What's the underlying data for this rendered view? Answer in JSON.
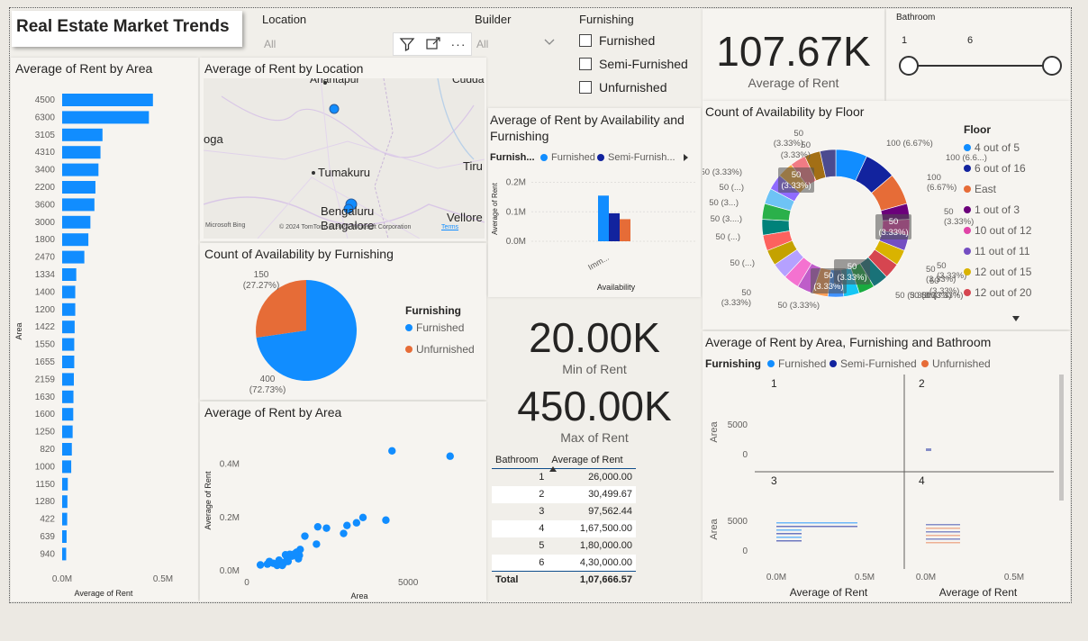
{
  "title": "Real Estate Market Trends",
  "slicers": {
    "location": {
      "label": "Location",
      "value": "All"
    },
    "builder": {
      "label": "Builder",
      "value": "All"
    },
    "furnishing": {
      "label": "Furnishing",
      "options": [
        "Furnished",
        "Semi-Furnished",
        "Unfurnished"
      ]
    },
    "bathroom": {
      "label": "Bathroom",
      "min": "1",
      "max": "6"
    }
  },
  "kpis": {
    "avg_rent": {
      "value": "107.67K",
      "label": "Average of Rent"
    },
    "min_rent": {
      "value": "20.00K",
      "label": "Min of Rent"
    },
    "max_rent": {
      "value": "450.00K",
      "label": "Max of Rent"
    }
  },
  "visual_titles": {
    "area_bar": "Average of Rent by Area",
    "location_map": "Average of Rent by Location",
    "furnishing_pie": "Count of Availability by Furnishing",
    "area_scatter": "Average of Rent by Area",
    "availability_bar": "Average of Rent by Availability and Furnishing",
    "floor_donut": "Count of Availability by Floor",
    "small_multiples": "Average of Rent by Area, Furnishing and Bathroom"
  },
  "map": {
    "places": [
      "Anantapur",
      "Cudda",
      "oga",
      "Tumakuru",
      "Tiru",
      "Bengaluru",
      "Bangalore",
      "Vellore"
    ],
    "attribution": "© 2024 TomTom, © 2024 Microsoft Corporation",
    "terms": "Terms",
    "bing": "Microsoft Bing"
  },
  "table": {
    "headers": [
      "Bathroom",
      "Average of Rent"
    ],
    "rows": [
      [
        "1",
        "26,000.00"
      ],
      [
        "2",
        "30,499.67"
      ],
      [
        "3",
        "97,562.44"
      ],
      [
        "4",
        "1,67,500.00"
      ],
      [
        "5",
        "1,80,000.00"
      ],
      [
        "6",
        "4,30,000.00"
      ]
    ],
    "total": [
      "Total",
      "1,07,666.57"
    ]
  },
  "colors": {
    "furnished": "#118dff",
    "semi": "#12239e",
    "unfurnished": "#e66c37"
  },
  "chart_data": [
    {
      "type": "bar",
      "title": "Average of Rent by Area",
      "xlabel": "Average of Rent",
      "ylabel": "Area",
      "x_ticks": [
        "0.0M",
        "0.5M"
      ],
      "categories": [
        "4500",
        "6300",
        "3105",
        "4310",
        "3400",
        "2200",
        "3600",
        "3000",
        "1800",
        "2470",
        "1334",
        "1400",
        "1200",
        "1422",
        "1550",
        "1655",
        "2159",
        "1630",
        "1600",
        "1250",
        "820",
        "1000",
        "1150",
        "1280",
        "422",
        "639",
        "940"
      ],
      "values": [
        450000,
        430000,
        200000,
        190000,
        180000,
        165000,
        160000,
        140000,
        130000,
        110000,
        70000,
        65000,
        65000,
        62000,
        60000,
        60000,
        58000,
        56000,
        55000,
        52000,
        48000,
        45000,
        28000,
        26000,
        25000,
        22000,
        20000
      ],
      "xlim": [
        0,
        500000
      ]
    },
    {
      "type": "pie",
      "title": "Count of Availability by Furnishing",
      "legend_title": "Furnishing",
      "categories": [
        "Furnished",
        "Unfurnished"
      ],
      "values": [
        400,
        150
      ],
      "labels": [
        "400\n(72.73%)",
        "150\n(27.27%)"
      ]
    },
    {
      "type": "scatter",
      "title": "Average of Rent by Area",
      "xlabel": "Area",
      "ylabel": "Average of Rent",
      "x_ticks": [
        "0",
        "5000"
      ],
      "y_ticks": [
        "0.0M",
        "0.2M",
        "0.4M"
      ],
      "xlim": [
        0,
        7200
      ],
      "ylim": [
        0,
        500000
      ],
      "points": [
        [
          4500,
          450000
        ],
        [
          6300,
          430000
        ],
        [
          3600,
          200000
        ],
        [
          3400,
          180000
        ],
        [
          4310,
          190000
        ],
        [
          3105,
          170000
        ],
        [
          3000,
          140000
        ],
        [
          2470,
          160000
        ],
        [
          2200,
          165000
        ],
        [
          1800,
          130000
        ],
        [
          2159,
          100000
        ],
        [
          1655,
          80000
        ],
        [
          1550,
          70000
        ],
        [
          1422,
          60000
        ],
        [
          1334,
          62000
        ],
        [
          1400,
          55000
        ],
        [
          1200,
          60000
        ],
        [
          1630,
          58000
        ],
        [
          1600,
          45000
        ],
        [
          1250,
          48000
        ],
        [
          1000,
          40000
        ],
        [
          1150,
          30000
        ],
        [
          1280,
          35000
        ],
        [
          820,
          28000
        ],
        [
          940,
          20000
        ],
        [
          639,
          25000
        ],
        [
          422,
          22000
        ],
        [
          700,
          35000
        ],
        [
          1100,
          20000
        ],
        [
          1500,
          65000
        ]
      ]
    },
    {
      "type": "bar",
      "title": "Average of Rent by Availability and Furnishing",
      "legend_title": "Furnish...",
      "xlabel": "Availability",
      "ylabel": "Average of Rent",
      "y_ticks": [
        "0.0M",
        "0.1M",
        "0.2M"
      ],
      "ylim": [
        0,
        0.22
      ],
      "categories": [
        "Imm..."
      ],
      "series": [
        {
          "name": "Furnished",
          "values": [
            0.155
          ]
        },
        {
          "name": "Semi-Furnish...",
          "values": [
            0.095
          ]
        },
        {
          "name": "Unfurnished",
          "values": [
            0.075
          ]
        }
      ]
    },
    {
      "type": "pie",
      "title": "Count of Availability by Floor",
      "legend_title": "Floor",
      "legend": [
        "4 out of 5",
        "6 out of 16",
        "East",
        "1 out of 3",
        "10 out of 12",
        "11 out of 11",
        "12 out of 15",
        "12 out of 20"
      ],
      "values": [
        100,
        100,
        100,
        50,
        50,
        50,
        50,
        50,
        50,
        50,
        50,
        50,
        50,
        50,
        50,
        50,
        50,
        50,
        50,
        50,
        50,
        50,
        50,
        50,
        50,
        50
      ],
      "data_labels": [
        "100 (6.67%)",
        "100 (6.6...)",
        "100\n(6.67%)",
        "50\n(3.33%)",
        "50\n(3.33%)",
        "50\n(3.33%)",
        "50 (3.33%)",
        "50 (3.33%)",
        "50\n(3.33%)",
        "50 (3.33%)",
        "50 (3.33%)",
        "50\n(3.33%)",
        "50 (...)",
        "50 (...)",
        "50 (3....)",
        "50 (3...)",
        "50 (...)",
        "50 (3.33%)",
        "50\n(3.33%)",
        "50\n(3.33%)"
      ]
    },
    {
      "type": "bar",
      "title": "Average of Rent by Area, Furnishing and Bathroom",
      "legend_title": "Furnishing",
      "legend": [
        "Furnished",
        "Semi-Furnished",
        "Unfurnished"
      ],
      "xlabel": "Average of Rent",
      "ylabel": "Area",
      "x_ticks": [
        "0.0M",
        "0.5M"
      ],
      "y_ticks": [
        "0",
        "5000"
      ],
      "panels": [
        "1",
        "2",
        "3",
        "4"
      ]
    }
  ]
}
